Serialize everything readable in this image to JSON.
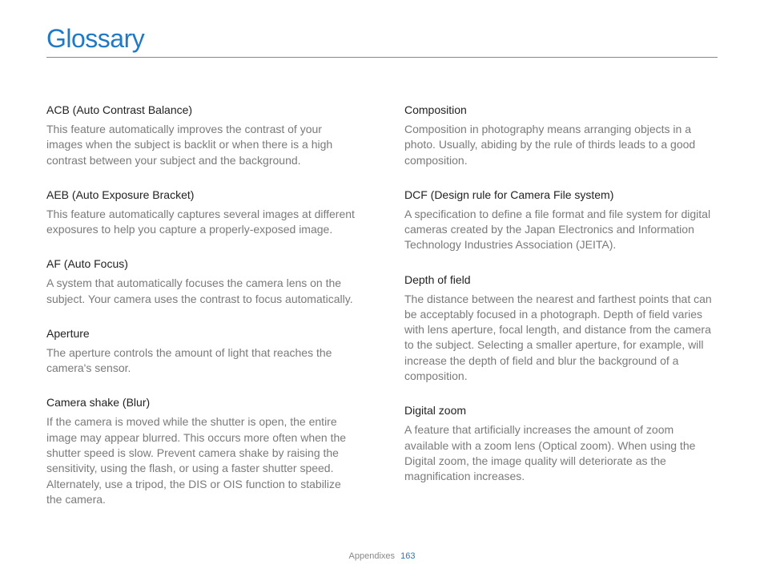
{
  "page_title": "Glossary",
  "left": [
    {
      "term": "ACB (Auto Contrast Balance)",
      "def": "This feature automatically improves the contrast of your images when the subject is backlit or when there is a high contrast between your subject and the background."
    },
    {
      "term": "AEB (Auto Exposure Bracket)",
      "def": "This feature automatically captures several images at different exposures to help you capture a properly-exposed image."
    },
    {
      "term": "AF (Auto Focus)",
      "def": "A system that automatically focuses the camera lens on the subject. Your camera uses the contrast to focus automatically."
    },
    {
      "term": "Aperture",
      "def": "The aperture controls the amount of light that reaches the camera's sensor."
    },
    {
      "term": "Camera shake (Blur)",
      "def": "If the camera is moved while the shutter is open, the entire image may appear blurred. This occurs more often when the shutter speed is slow. Prevent camera shake by raising the sensitivity, using the flash, or using a faster shutter speed. Alternately, use a tripod, the DIS or OIS function to stabilize the camera."
    }
  ],
  "right": [
    {
      "term": "Composition",
      "def": "Composition in photography means arranging objects in a photo. Usually, abiding by the rule of thirds leads to a good composition."
    },
    {
      "term": "DCF (Design rule for Camera File system)",
      "def": "A specification to define a file format and file system for digital cameras created by the Japan Electronics and Information Technology Industries Association (JEITA)."
    },
    {
      "term": "Depth of field",
      "def": "The distance between the nearest and farthest points that can be acceptably focused in a photograph. Depth of field varies with lens aperture, focal length, and distance from the camera to the subject. Selecting a smaller aperture, for example, will increase the depth of field and blur the background of a composition."
    },
    {
      "term": "Digital zoom",
      "def": "A feature that artificially increases the amount of zoom available with a zoom lens (Optical zoom). When using the Digital zoom, the image quality will deteriorate as the magnification increases."
    }
  ],
  "footer_section": "Appendixes",
  "footer_page": "163"
}
